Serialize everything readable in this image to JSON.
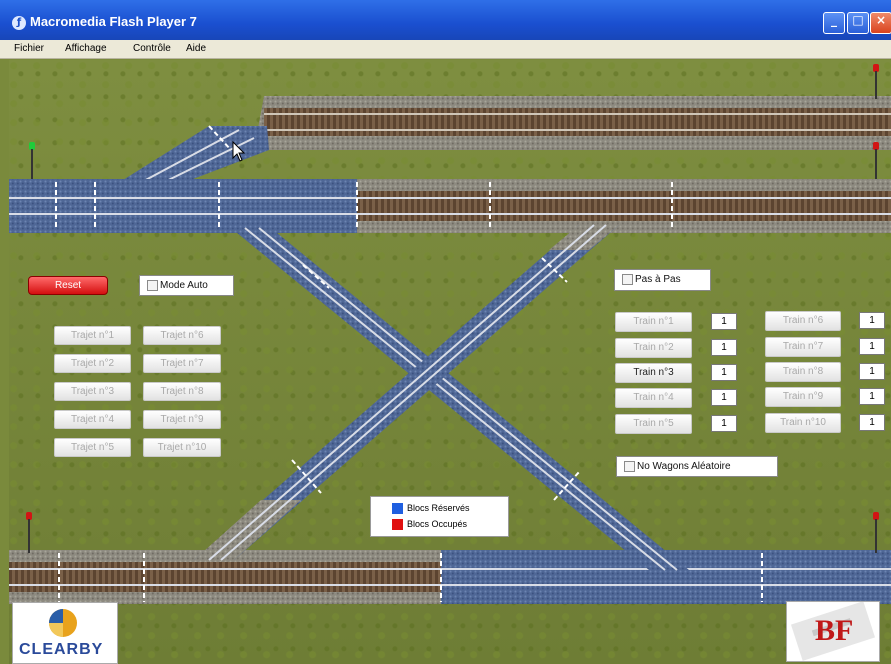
{
  "window": {
    "title": "Macromedia Flash Player 7",
    "controls": {
      "minimize": "_",
      "maximize": "□",
      "close": "×"
    }
  },
  "menu": [
    "Fichier",
    "Affichage",
    "Contrôle",
    "Aide"
  ],
  "colors": {
    "reserved": "#1f5fe0",
    "occupied": "#e01010",
    "reset": "#e02020",
    "track_blue": "#4e6693",
    "ballast": "#8a8a82"
  },
  "controls": {
    "reset_label": "Reset",
    "mode_auto_label": "Mode Auto",
    "pas_a_pas_label": "Pas à Pas",
    "wagons_label": "No Wagons Aléatoire"
  },
  "trajets": [
    {
      "label": "Trajet n°1"
    },
    {
      "label": "Trajet n°2"
    },
    {
      "label": "Trajet n°3"
    },
    {
      "label": "Trajet n°4"
    },
    {
      "label": "Trajet n°5"
    },
    {
      "label": "Trajet n°6"
    },
    {
      "label": "Trajet n°7"
    },
    {
      "label": "Trajet n°8"
    },
    {
      "label": "Trajet n°9"
    },
    {
      "label": "Trajet n°10"
    }
  ],
  "trains": [
    {
      "label": "Train n°1",
      "value": "1"
    },
    {
      "label": "Train n°2",
      "value": "1"
    },
    {
      "label": "Train n°3",
      "value": "1",
      "active": true
    },
    {
      "label": "Train n°4",
      "value": "1"
    },
    {
      "label": "Train n°5",
      "value": "1"
    },
    {
      "label": "Train n°6",
      "value": "1"
    },
    {
      "label": "Train n°7",
      "value": "1"
    },
    {
      "label": "Train n°8",
      "value": "1"
    },
    {
      "label": "Train n°9",
      "value": "1"
    },
    {
      "label": "Train n°10",
      "value": "1"
    }
  ],
  "legend": {
    "reserved": "Blocs Réservés",
    "occupied": "Blocs Occupés"
  },
  "logos": {
    "left": "CLEARBY",
    "right": "BF"
  }
}
